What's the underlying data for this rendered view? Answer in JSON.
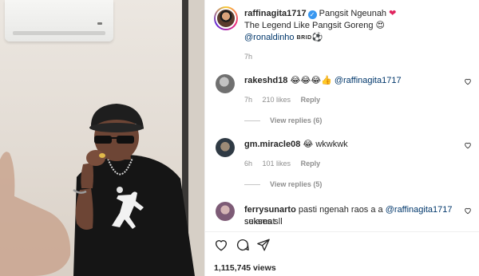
{
  "post": {
    "username": "raffinagita1717",
    "caption_line1": "Pangsit Ngeunah",
    "caption_line2": "The Legend Like Pangsit Goreng",
    "caption_mention": "@ronaldinho",
    "caption_tag": "BRID",
    "time": "7h",
    "views": "1,115,745 views"
  },
  "comments": [
    {
      "username": "rakeshd18",
      "emojis": "😂😂😂👍",
      "text": "@raffinagita1717",
      "time": "7h",
      "likes": "210 likes",
      "reply_label": "Reply",
      "view_replies": "View replies (6)"
    },
    {
      "username": "gm.miracle08",
      "emojis": "😂",
      "text": "wkwkwk",
      "time": "6h",
      "likes": "101 likes",
      "reply_label": "Reply",
      "view_replies": "View replies (5)"
    },
    {
      "username": "ferrysunarto",
      "text_before": "pasti ngenah raos a a",
      "mention": "@raffinagita1717",
      "text_after": "selamat",
      "text_line2": "sukses sll"
    }
  ],
  "icons": {
    "verified": "verified-badge-icon",
    "heart": "heart-icon",
    "comment": "comment-icon",
    "share": "share-icon"
  },
  "colors": {
    "mention": "#00376b",
    "muted": "#8e8e8e",
    "verified": "#3897f0",
    "red_heart": "#e0245e"
  }
}
